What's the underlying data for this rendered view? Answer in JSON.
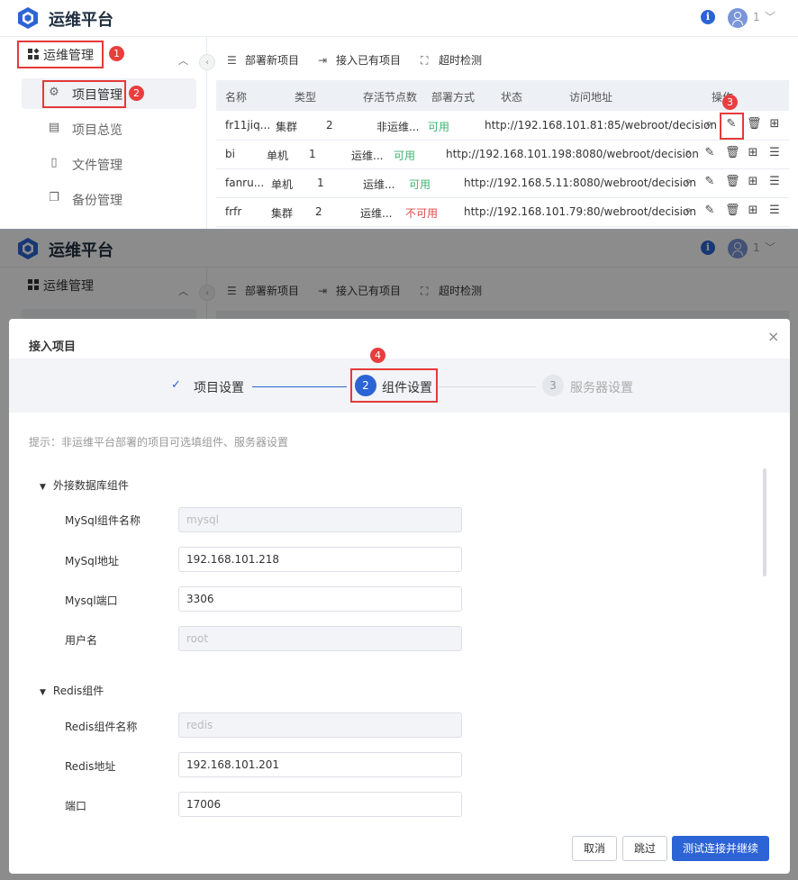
{
  "app": {
    "title": "运维平台",
    "user": "1"
  },
  "sidebar": {
    "group_label": "运维管理",
    "items": [
      {
        "label": "项目管理",
        "icon": "gear-icon",
        "active": true
      },
      {
        "label": "项目总览",
        "icon": "overview-icon",
        "active": false
      },
      {
        "label": "文件管理",
        "icon": "file-icon",
        "active": false
      },
      {
        "label": "备份管理",
        "icon": "backup-icon",
        "active": false
      }
    ]
  },
  "toolbar": {
    "deploy_label": "部署新项目",
    "import_label": "接入已有项目",
    "timeout_label": "超时检测"
  },
  "table": {
    "columns": [
      "名称",
      "类型",
      "存活节点数",
      "部署方式",
      "状态",
      "访问地址",
      "操作"
    ],
    "rows": [
      {
        "name": "fr11jiq...",
        "type": "集群",
        "nodes": "2",
        "deploy": "非运维...",
        "status": "可用",
        "url": "http://192.168.101.81:85/webroot/decision"
      },
      {
        "name": "bi",
        "type": "单机",
        "nodes": "1",
        "deploy": "运维...",
        "status": "可用",
        "url": "http://192.168.101.198:8080/webroot/decision"
      },
      {
        "name": "fanru...",
        "type": "单机",
        "nodes": "1",
        "deploy": "运维...",
        "status": "可用",
        "url": "http://192.168.5.11:8080/webroot/decision"
      },
      {
        "name": "frfr",
        "type": "集群",
        "nodes": "2",
        "deploy": "运维...",
        "status": "不可用",
        "url": "http://192.168.101.79:80/webroot/decision"
      }
    ]
  },
  "badges": [
    "1",
    "2",
    "3",
    "4"
  ],
  "modal": {
    "title": "接入项目",
    "close": "×",
    "steps": [
      {
        "num": "✓",
        "label": "项目设置",
        "state": "done"
      },
      {
        "num": "2",
        "label": "组件设置",
        "state": "active"
      },
      {
        "num": "3",
        "label": "服务器设置",
        "state": "pending"
      }
    ],
    "hint": "提示：非运维平台部署的项目可选填组件、服务器设置",
    "sections": [
      {
        "title": "外接数据库组件",
        "fields": [
          {
            "label": "MySql组件名称",
            "value": "mysql",
            "disabled": true
          },
          {
            "label": "MySql地址",
            "value": "192.168.101.218",
            "disabled": false
          },
          {
            "label": "Mysql端口",
            "value": "3306",
            "disabled": false
          },
          {
            "label": "用户名",
            "value": "root",
            "disabled": true
          }
        ]
      },
      {
        "title": "Redis组件",
        "fields": [
          {
            "label": "Redis组件名称",
            "value": "redis",
            "disabled": true
          },
          {
            "label": "Redis地址",
            "value": "192.168.101.201",
            "disabled": false
          },
          {
            "label": "端口",
            "value": "17006",
            "disabled": false
          }
        ]
      }
    ],
    "buttons": {
      "cancel": "取消",
      "skip": "跳过",
      "test": "测试连接并继续"
    }
  },
  "colors": {
    "primary": "#2c64d6",
    "danger": "#e34848",
    "success": "#3cb371",
    "annotation": "#e33a3a"
  }
}
